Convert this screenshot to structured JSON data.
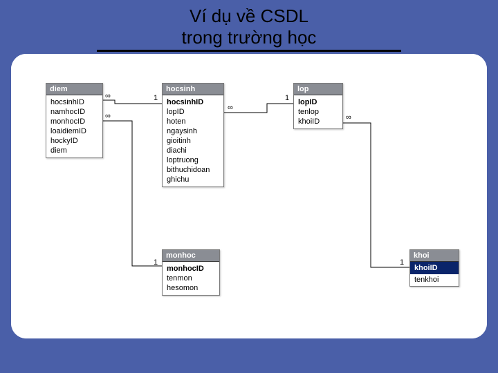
{
  "title": {
    "line1": "Ví dụ về CSDL",
    "line2": "trong trường học"
  },
  "tables": {
    "diem": {
      "name": "diem",
      "fields": [
        "hocsinhID",
        "namhocID",
        "monhocID",
        "loaidiemID",
        "hockyID",
        "diem"
      ]
    },
    "hocsinh": {
      "name": "hocsinh",
      "fields": [
        "hocsinhID",
        "lopID",
        "hoten",
        "ngaysinh",
        "gioitinh",
        "diachi",
        "loptruong",
        "bithuchidoan",
        "ghichu"
      ],
      "pk": "hocsinhID"
    },
    "lop": {
      "name": "lop",
      "fields": [
        "lopID",
        "tenlop",
        "khoiID"
      ],
      "pk": "lopID"
    },
    "monhoc": {
      "name": "monhoc",
      "fields": [
        "monhocID",
        "tenmon",
        "hesomon"
      ],
      "pk": "monhocID"
    },
    "khoi": {
      "name": "khoi",
      "fields": [
        "khoiID",
        "tenkhoi"
      ],
      "selected": "khoiID"
    }
  },
  "relations": {
    "inf": "∞",
    "one": "1"
  }
}
